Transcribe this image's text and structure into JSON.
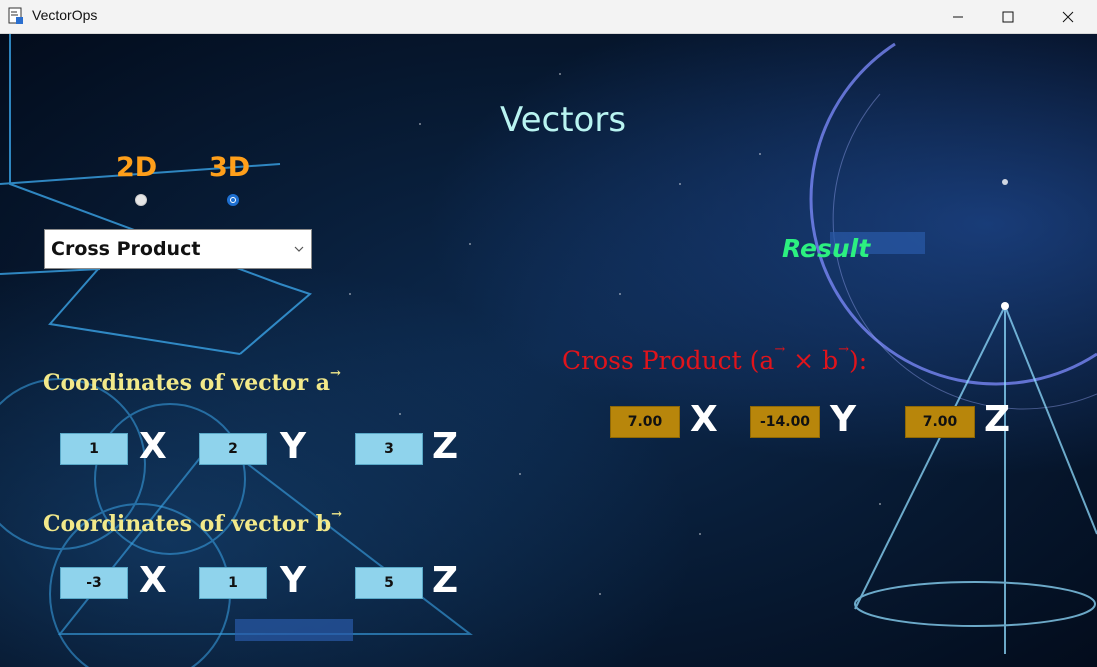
{
  "window": {
    "title": "VectorOps"
  },
  "header": {
    "heading": "Vectors"
  },
  "mode": {
    "options": [
      {
        "label": "2D",
        "selected": false
      },
      {
        "label": "3D",
        "selected": true
      }
    ]
  },
  "operation": {
    "selected": "Cross Product"
  },
  "vector_a": {
    "label": "Coordinates of vector a",
    "x": "1",
    "y": "2",
    "z": "3"
  },
  "vector_b": {
    "label": "Coordinates of vector b",
    "x": "-3",
    "y": "1",
    "z": "5"
  },
  "axes": {
    "x": "X",
    "y": "Y",
    "z": "Z"
  },
  "result": {
    "title": "Result",
    "operation_label_prefix": "Cross Product (a",
    "operation_label_mid": " × b",
    "operation_label_suffix": "):",
    "x": "7.00",
    "y": "-14.00",
    "z": "7.00"
  },
  "colors": {
    "heading": "#b9f4f1",
    "mode_label": "#ff9f1a",
    "section_label": "#f2e98a",
    "result_label": "#2cf080",
    "operation_label": "#e0141b",
    "input_box": "#8fd3ec",
    "output_box": "#b8860b"
  }
}
